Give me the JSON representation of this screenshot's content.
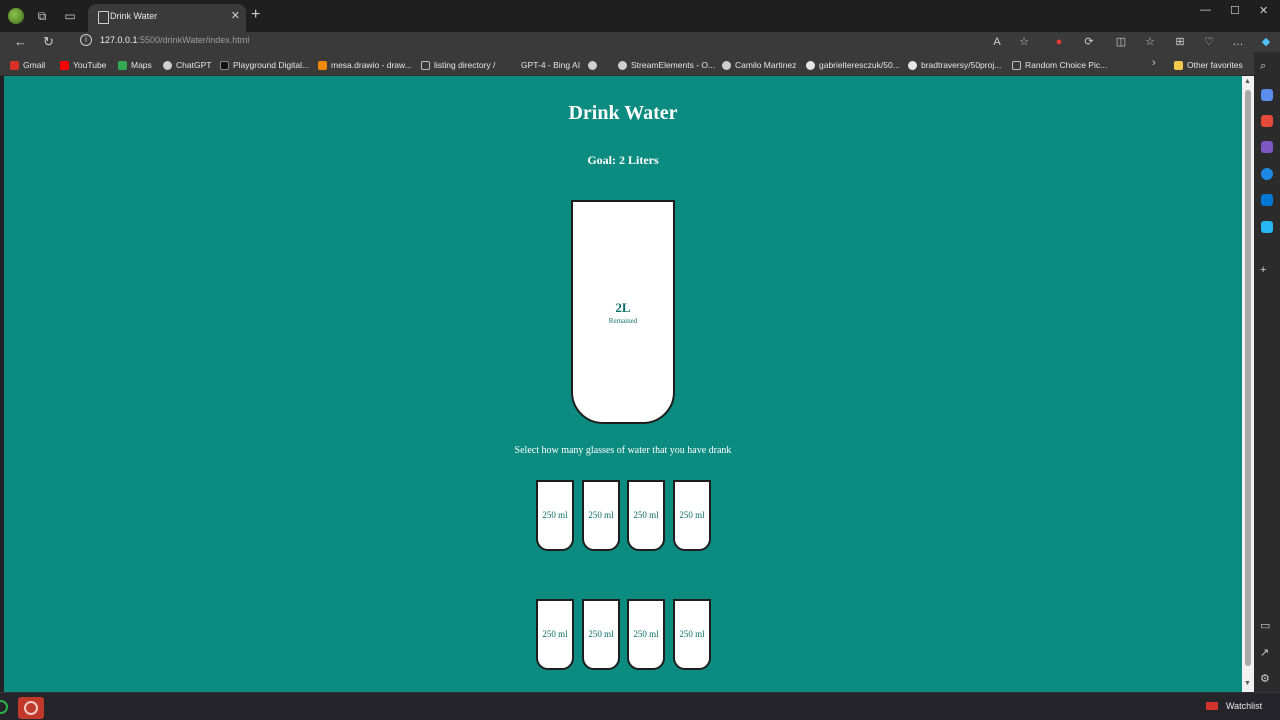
{
  "browser": {
    "tab_title": "Drink Water",
    "url_host": "127.0.0.1",
    "url_path": ":5500/drinkWater/index.html",
    "bookmarks": [
      {
        "label": "Gmail",
        "color": "#d93025"
      },
      {
        "label": "YouTube",
        "color": "#ff0000"
      },
      {
        "label": "Maps",
        "color": "#34a853"
      },
      {
        "label": "ChatGPT",
        "color": "#cfcfcf"
      },
      {
        "label": "Playground Digital...",
        "color": "#1a1a1a"
      },
      {
        "label": "mesa.drawio - draw...",
        "color": "#f08705"
      },
      {
        "label": "listing directory /",
        "color": "#9e9e9e"
      },
      {
        "label": "GPT-4 - Bing AI",
        "color": "#3a3a3a"
      },
      {
        "label": "StreamElements - O...",
        "color": "#cfcfcf"
      },
      {
        "label": "Camilo Martinez",
        "color": "#cfcfcf"
      },
      {
        "label": "gabrielteresczuk/50...",
        "color": "#cfcfcf"
      },
      {
        "label": "bradtraversy/50proj...",
        "color": "#cfcfcf"
      },
      {
        "label": "Random Choice Pic...",
        "color": "#9e9e9e"
      }
    ],
    "other_favorites": "Other favorites"
  },
  "page": {
    "title": "Drink Water",
    "goal": "Goal: 2 Liters",
    "remained_amount": "2L",
    "remained_label": "Remained",
    "instructions": "Select how many glasses of water that you have drank",
    "cups": [
      "250 ml",
      "250 ml",
      "250 ml",
      "250 ml",
      "250 ml",
      "250 ml",
      "250 ml",
      "250 ml"
    ]
  },
  "taskbar": {
    "watchlist": "Watchlist"
  },
  "colors": {
    "background": "#0c8c80",
    "cup_text": "#0c6f66"
  }
}
